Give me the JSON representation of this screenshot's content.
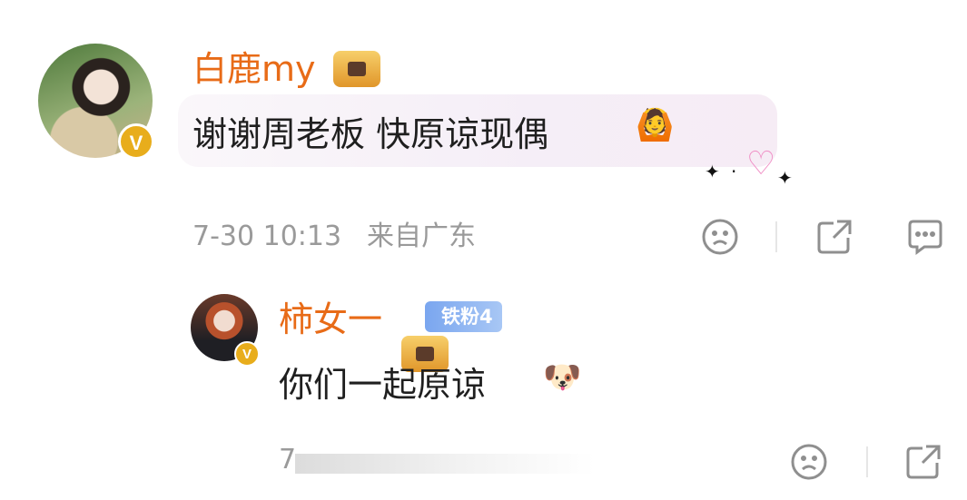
{
  "comment": {
    "username": "白鹿my",
    "text": "谢谢周老板 快原谅现偶",
    "emoji": "🙆",
    "time": "7-30 10:13",
    "location": "来自广东",
    "verified_badge": "V"
  },
  "reply": {
    "username": "柿女一",
    "fan_badge": "铁粉4",
    "text": "你们一起原谅",
    "emoji": "🐶",
    "time": "7-",
    "verified_badge": "V"
  },
  "icons": {
    "dislike": "sad-face-icon",
    "share": "share-icon",
    "comment": "comment-icon"
  },
  "colors": {
    "username": "#e86b17",
    "text": "#1f1f1f",
    "meta": "#9a9a9a",
    "badge": "#e8ad1c",
    "fan_badge": "#7aa6ef"
  }
}
